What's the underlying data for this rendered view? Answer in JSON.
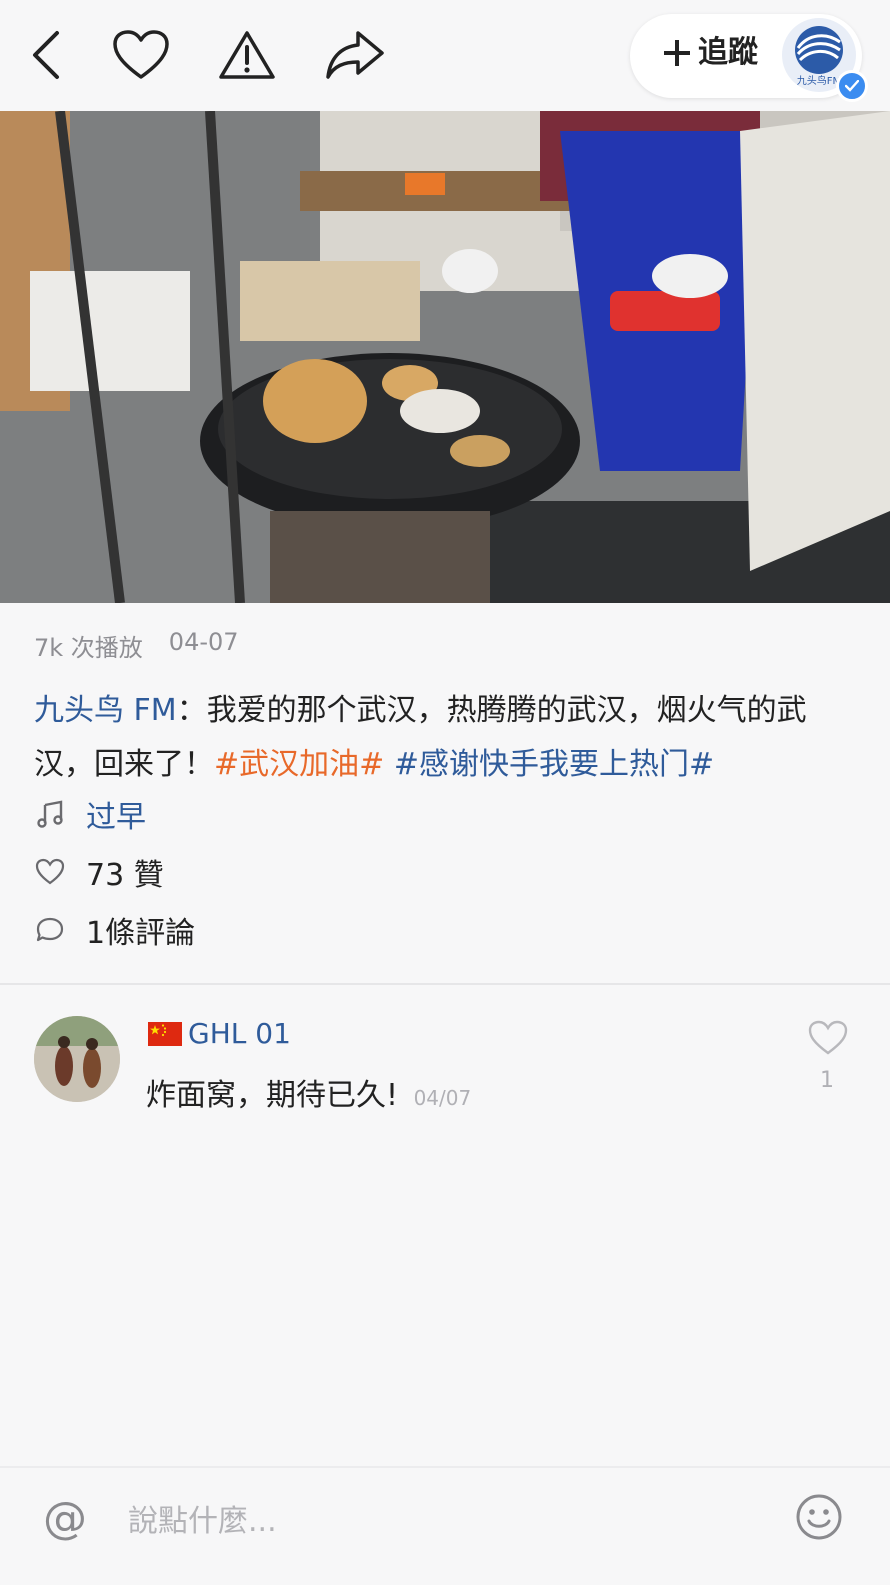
{
  "header": {
    "follow_label": "追蹤",
    "author_avatar_text": "九头鸟FM"
  },
  "video": {
    "views": "7k 次播放",
    "date": "04-07"
  },
  "caption": {
    "author": "九头鸟 FM",
    "colon": "：",
    "text": "我爱的那个武汉，热腾腾的武汉，烟火气的武汉，回来了！",
    "tag1": "#武汉加油#",
    "tag2": "#感谢快手我要上热门#"
  },
  "info": {
    "music": "过早",
    "likes": "73 贊",
    "comments": "1條評論"
  },
  "comments": [
    {
      "user": "GHL 01",
      "text": "炸面窝，期待已久!",
      "time": "04/07",
      "likes": "1"
    }
  ],
  "input": {
    "placeholder": "說點什麼..."
  },
  "colors": {
    "link_blue": "#2f5b9a",
    "tag_orange": "#e8692a",
    "verify_blue": "#3b8cf0"
  }
}
